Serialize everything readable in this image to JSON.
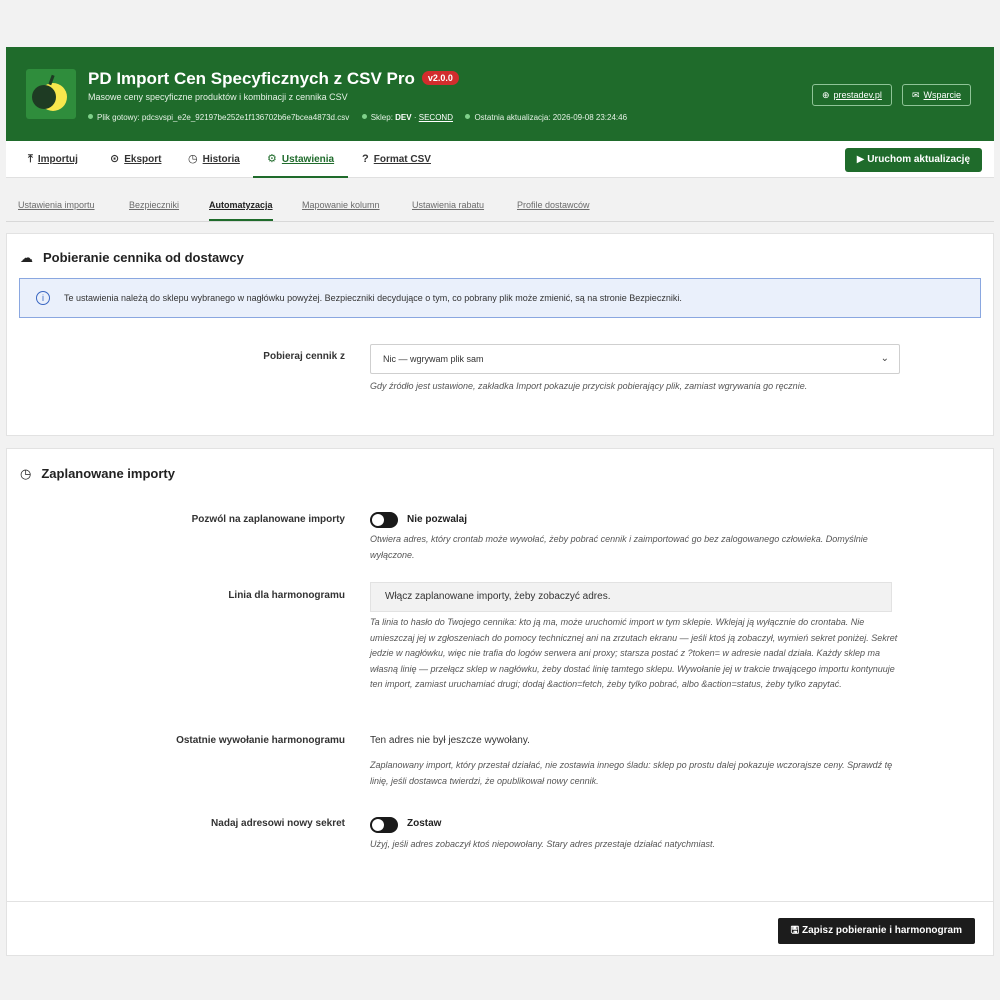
{
  "header": {
    "title": "PD Import Cen Specyficznych z CSV Pro",
    "version": "v2.0.0",
    "subtitle": "Masowe ceny specyficzne produktów i kombinacji z cennika CSV",
    "file_label": "Plik gotowy:",
    "file_name": "pdcsvspi_e2e_92197be252e1f136702b6e7bcea4873d.csv",
    "shop_label": "Sklep:",
    "shop_env": "DEV",
    "shop_sep": "·",
    "shop_name": "SECOND",
    "updated_label": "Ostatnia aktualizacja:",
    "updated_value": "2026-09-08 23:24:46",
    "link_site": "prestadev.pl",
    "link_support": "Wsparcie",
    "accent": "#1f6b2b"
  },
  "nav": {
    "tabs": [
      {
        "label": "Importuj",
        "icon": "upload-icon"
      },
      {
        "label": "Eksport",
        "icon": "download-icon"
      },
      {
        "label": "Historia",
        "icon": "history-icon"
      },
      {
        "label": "Ustawienia",
        "icon": "gears-icon"
      },
      {
        "label": "Format CSV",
        "icon": "question-icon"
      }
    ],
    "active": "Ustawienia",
    "run_button": "Uruchom aktualizację"
  },
  "subtabs": {
    "items": [
      "Ustawienia importu",
      "Bezpieczniki",
      "Automatyzacja",
      "Mapowanie kolumn",
      "Ustawienia rabatu",
      "Profile dostawców"
    ],
    "active": "Automatyzacja"
  },
  "download": {
    "title": "Pobieranie cennika od dostawcy",
    "alert": "Te ustawienia należą do sklepu wybranego w nagłówku powyżej. Bezpieczniki decydujące o tym, co pobrany plik może zmienić, są na stronie Bezpieczniki.",
    "source_label": "Pobieraj cennik z",
    "source_value": "Nic — wgrywam plik sam",
    "source_help": "Gdy źródło jest ustawione, zakładka Import pokazuje przycisk pobierający plik, zamiast wgrywania go ręcznie."
  },
  "schedule": {
    "title": "Zaplanowane importy",
    "allow_label": "Pozwól na zaplanowane importy",
    "allow_state": "Nie pozwalaj",
    "allow_help": "Otwiera adres, który crontab może wywołać, żeby pobrać cennik i zaimportować go bez zalogowanego człowieka. Domyślnie wyłączone.",
    "line_label": "Linia dla harmonogramu",
    "line_value": "Włącz zaplanowane importy, żeby zobaczyć adres.",
    "line_help": "Ta linia to hasło do Twojego cennika: kto ją ma, może uruchomić import w tym sklepie. Wklejaj ją wyłącznie do crontaba. Nie umieszczaj jej w zgłoszeniach do pomocy technicznej ani na zrzutach ekranu — jeśli ktoś ją zobaczył, wymień sekret poniżej. Sekret jedzie w nagłówku, więc nie trafia do logów serwera ani proxy; starsza postać z ?token= w adresie nadal działa. Każdy sklep ma własną linię — przełącz sklep w nagłówku, żeby dostać linię tamtego sklepu. Wywołanie jej w trakcie trwającego importu kontynuuje ten import, zamiast uruchamiać drugi; dodaj &action=fetch, żeby tylko pobrać, albo &action=status, żeby tylko zapytać.",
    "last_label": "Ostatnie wywołanie harmonogramu",
    "last_value": "Ten adres nie był jeszcze wywołany.",
    "last_help": "Zaplanowany import, który przestał działać, nie zostawia innego śladu: sklep po prostu dalej pokazuje wczorajsze ceny. Sprawdź tę linię, jeśli dostawca twierdzi, że opublikował nowy cennik.",
    "secret_label": "Nadaj adresowi nowy sekret",
    "secret_state": "Zostaw",
    "secret_help": "Użyj, jeśli adres zobaczył ktoś niepowołany. Stary adres przestaje działać natychmiast.",
    "save_button": "Zapisz pobieranie i harmonogram"
  }
}
